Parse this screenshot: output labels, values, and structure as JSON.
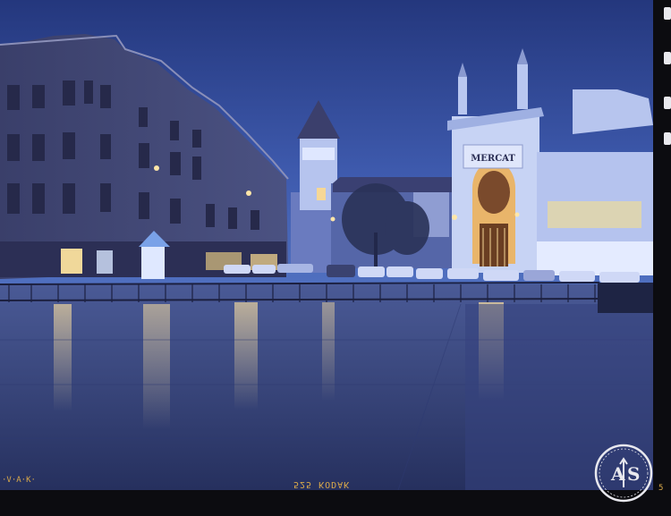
{
  "photo": {
    "description_colors": {
      "sky_top": "#2a3f8a",
      "sky_bottom": "#4a68b8",
      "plaza": "#3b4c8c",
      "lights": "#ffd88a"
    },
    "sign_text": "MERCAT"
  },
  "film": {
    "edge_code": "525 KODAK",
    "edge_code_left": "·V·A·K·",
    "frame_number": "5"
  },
  "stamp": {
    "monogram": "AS"
  }
}
